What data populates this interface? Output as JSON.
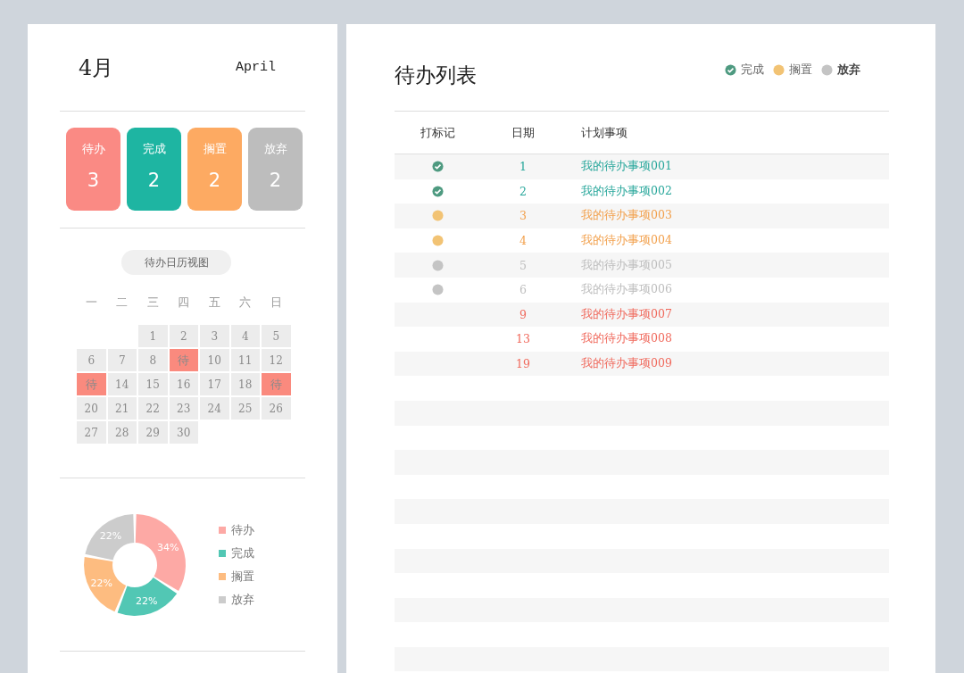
{
  "month": {
    "title": "4月",
    "english": "April"
  },
  "stats": [
    {
      "label": "待办",
      "count": "3",
      "color": "#fa8a84"
    },
    {
      "label": "完成",
      "count": "2",
      "color": "#1eb5a2"
    },
    {
      "label": "搁置",
      "count": "2",
      "color": "#fdaa62"
    },
    {
      "label": "放弃",
      "count": "2",
      "color": "#bdbdbd"
    }
  ],
  "calendar": {
    "button": "待办日历视图",
    "weekdays": [
      "一",
      "二",
      "三",
      "四",
      "五",
      "六",
      "日"
    ],
    "days": [
      {
        "kind": "blank"
      },
      {
        "kind": "blank"
      },
      {
        "kind": "day",
        "label": "1"
      },
      {
        "kind": "day",
        "label": "2"
      },
      {
        "kind": "day",
        "label": "3"
      },
      {
        "kind": "day",
        "label": "4"
      },
      {
        "kind": "day",
        "label": "5"
      },
      {
        "kind": "day",
        "label": "6"
      },
      {
        "kind": "day",
        "label": "7"
      },
      {
        "kind": "day",
        "label": "8"
      },
      {
        "kind": "todo",
        "label": "待"
      },
      {
        "kind": "day",
        "label": "10"
      },
      {
        "kind": "day",
        "label": "11"
      },
      {
        "kind": "day",
        "label": "12"
      },
      {
        "kind": "todo",
        "label": "待"
      },
      {
        "kind": "day",
        "label": "14"
      },
      {
        "kind": "day",
        "label": "15"
      },
      {
        "kind": "day",
        "label": "16"
      },
      {
        "kind": "day",
        "label": "17"
      },
      {
        "kind": "day",
        "label": "18"
      },
      {
        "kind": "todo",
        "label": "待"
      },
      {
        "kind": "day",
        "label": "20"
      },
      {
        "kind": "day",
        "label": "21"
      },
      {
        "kind": "day",
        "label": "22"
      },
      {
        "kind": "day",
        "label": "23"
      },
      {
        "kind": "day",
        "label": "24"
      },
      {
        "kind": "day",
        "label": "25"
      },
      {
        "kind": "day",
        "label": "26"
      },
      {
        "kind": "day",
        "label": "27"
      },
      {
        "kind": "day",
        "label": "28"
      },
      {
        "kind": "day",
        "label": "29"
      },
      {
        "kind": "day",
        "label": "30"
      }
    ]
  },
  "chart": {
    "chart_data": {
      "type": "donut",
      "values": [
        34,
        22,
        22,
        22
      ],
      "data_labels": true,
      "value_labels": [
        "34%",
        "22%",
        "22%",
        "22%"
      ]
    },
    "legend": [
      {
        "label": "待办",
        "color": "#fda9a5"
      },
      {
        "label": "完成",
        "color": "#52c7b4"
      },
      {
        "label": "搁置",
        "color": "#fdbc80"
      },
      {
        "label": "放弃",
        "color": "#cccccc"
      }
    ]
  },
  "todo": {
    "title": "待办列表",
    "legend": [
      {
        "kind": "done",
        "label": "完成"
      },
      {
        "kind": "shelved",
        "label": "搁置"
      },
      {
        "kind": "abandoned",
        "label": "放弃"
      }
    ],
    "columns": [
      "打标记",
      "日期",
      "计划事项"
    ],
    "rows": [
      {
        "kind": "done",
        "date": "1",
        "item": "我的待办事项001"
      },
      {
        "kind": "done",
        "date": "2",
        "item": "我的待办事项002"
      },
      {
        "kind": "shelved",
        "date": "3",
        "item": "我的待办事项003"
      },
      {
        "kind": "shelved",
        "date": "4",
        "item": "我的待办事项004"
      },
      {
        "kind": "abandoned",
        "date": "5",
        "item": "我的待办事项005"
      },
      {
        "kind": "abandoned",
        "date": "6",
        "item": "我的待办事项006"
      },
      {
        "kind": "pending",
        "date": "9",
        "item": "我的待办事项007"
      },
      {
        "kind": "pending",
        "date": "13",
        "item": "我的待办事项008"
      },
      {
        "kind": "pending",
        "date": "19",
        "item": "我的待办事项009"
      }
    ]
  }
}
